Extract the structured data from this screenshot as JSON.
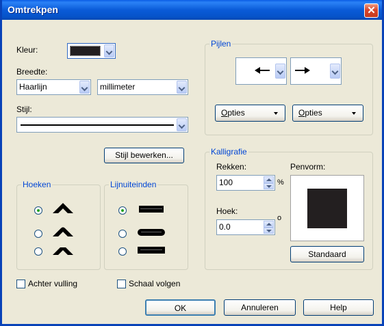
{
  "window": {
    "title": "Omtrekpen",
    "close_glyph": "✕"
  },
  "colors": {
    "accent": "#0046D5",
    "titlebar": "#0A5DE5",
    "pen_color": "#231F20",
    "close": "#D9452A"
  },
  "color": {
    "label": "Kleur:"
  },
  "width": {
    "label": "Breedte:",
    "value": "Haarlijn",
    "unit": "millimeter"
  },
  "style": {
    "label": "Stijl:",
    "edit_button": "Stijl bewerken..."
  },
  "corners": {
    "title": "Hoeken",
    "options": [
      {
        "selected": true
      },
      {
        "selected": false
      },
      {
        "selected": false
      }
    ]
  },
  "line_caps": {
    "title": "Lijnuiteinden",
    "options": [
      {
        "selected": true
      },
      {
        "selected": false
      },
      {
        "selected": false
      }
    ]
  },
  "arrows": {
    "title": "Pijlen",
    "start_arrow_icon": "left-arrow-icon",
    "end_arrow_icon": "right-arrow-icon",
    "options_left": {
      "accel": "O",
      "rest": "pties"
    },
    "options_right": {
      "accel": "O",
      "rest": "pties"
    }
  },
  "calligraphy": {
    "title": "Kalligrafie",
    "stretch_label": "Rekken:",
    "stretch_value": "100",
    "stretch_unit": "%",
    "angle_label": "Hoek:",
    "angle_value": "0.0",
    "angle_unit": "o",
    "nib_label": "Penvorm:",
    "default_button": "Standaard"
  },
  "checkboxes": {
    "behind_fill": {
      "label": "Achter vulling",
      "checked": false
    },
    "scale_with": {
      "label": "Schaal volgen",
      "checked": false
    }
  },
  "buttons": {
    "ok": "OK",
    "cancel": "Annuleren",
    "help": "Help"
  }
}
